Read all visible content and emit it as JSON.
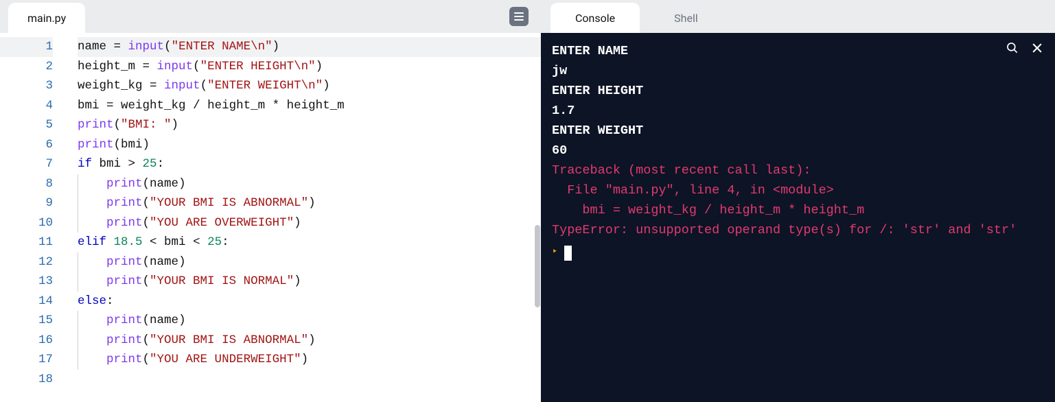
{
  "editor": {
    "filename": "main.py",
    "lines": [
      {
        "n": 1,
        "segs": [
          [
            "name",
            "name "
          ],
          [
            "op",
            "= "
          ],
          [
            "call",
            "input"
          ],
          [
            "paren",
            "("
          ],
          [
            "str",
            "\"ENTER NAME"
          ],
          [
            "esc",
            "\\n"
          ],
          [
            "str",
            "\""
          ],
          [
            "paren",
            ")"
          ]
        ]
      },
      {
        "n": 2,
        "segs": [
          [
            "name",
            "height_m "
          ],
          [
            "op",
            "= "
          ],
          [
            "call",
            "input"
          ],
          [
            "paren",
            "("
          ],
          [
            "str",
            "\"ENTER HEIGHT"
          ],
          [
            "esc",
            "\\n"
          ],
          [
            "str",
            "\""
          ],
          [
            "paren",
            ")"
          ]
        ]
      },
      {
        "n": 3,
        "segs": [
          [
            "name",
            "weight_kg "
          ],
          [
            "op",
            "= "
          ],
          [
            "call",
            "input"
          ],
          [
            "paren",
            "("
          ],
          [
            "str",
            "\"ENTER WEIGHT"
          ],
          [
            "esc",
            "\\n"
          ],
          [
            "str",
            "\""
          ],
          [
            "paren",
            ")"
          ]
        ]
      },
      {
        "n": 4,
        "segs": [
          [
            "name",
            "bmi "
          ],
          [
            "op",
            "= "
          ],
          [
            "name",
            "weight_kg "
          ],
          [
            "op",
            "/ "
          ],
          [
            "name",
            "height_m "
          ],
          [
            "op",
            "* "
          ],
          [
            "name",
            "height_m"
          ]
        ]
      },
      {
        "n": 5,
        "segs": [
          [
            "call",
            "print"
          ],
          [
            "paren",
            "("
          ],
          [
            "str",
            "\"BMI: \""
          ],
          [
            "paren",
            ")"
          ]
        ]
      },
      {
        "n": 6,
        "segs": [
          [
            "call",
            "print"
          ],
          [
            "paren",
            "("
          ],
          [
            "name",
            "bmi"
          ],
          [
            "paren",
            ")"
          ]
        ]
      },
      {
        "n": 7,
        "segs": [
          [
            "kw",
            "if "
          ],
          [
            "name",
            "bmi "
          ],
          [
            "op",
            "> "
          ],
          [
            "num",
            "25"
          ],
          [
            "op",
            ":"
          ]
        ]
      },
      {
        "n": 8,
        "indent": 1,
        "segs": [
          [
            "call",
            "print"
          ],
          [
            "paren",
            "("
          ],
          [
            "name",
            "name"
          ],
          [
            "paren",
            ")"
          ]
        ]
      },
      {
        "n": 9,
        "indent": 1,
        "segs": [
          [
            "call",
            "print"
          ],
          [
            "paren",
            "("
          ],
          [
            "str",
            "\"YOUR BMI IS ABNORMAL\""
          ],
          [
            "paren",
            ")"
          ]
        ]
      },
      {
        "n": 10,
        "indent": 1,
        "segs": [
          [
            "call",
            "print"
          ],
          [
            "paren",
            "("
          ],
          [
            "str",
            "\"YOU ARE OVERWEIGHT\""
          ],
          [
            "paren",
            ")"
          ]
        ]
      },
      {
        "n": 11,
        "segs": [
          [
            "kw",
            "elif "
          ],
          [
            "num",
            "18.5"
          ],
          [
            "op",
            " < "
          ],
          [
            "name",
            "bmi "
          ],
          [
            "op",
            "< "
          ],
          [
            "num",
            "25"
          ],
          [
            "op",
            ":"
          ]
        ]
      },
      {
        "n": 12,
        "indent": 1,
        "segs": [
          [
            "call",
            "print"
          ],
          [
            "paren",
            "("
          ],
          [
            "name",
            "name"
          ],
          [
            "paren",
            ")"
          ]
        ]
      },
      {
        "n": 13,
        "indent": 1,
        "segs": [
          [
            "call",
            "print"
          ],
          [
            "paren",
            "("
          ],
          [
            "str",
            "\"YOUR BMI IS NORMAL\""
          ],
          [
            "paren",
            ")"
          ]
        ]
      },
      {
        "n": 14,
        "segs": [
          [
            "kw",
            "else"
          ],
          [
            "op",
            ":"
          ]
        ]
      },
      {
        "n": 15,
        "indent": 1,
        "segs": [
          [
            "call",
            "print"
          ],
          [
            "paren",
            "("
          ],
          [
            "name",
            "name"
          ],
          [
            "paren",
            ")"
          ]
        ]
      },
      {
        "n": 16,
        "indent": 1,
        "segs": [
          [
            "call",
            "print"
          ],
          [
            "paren",
            "("
          ],
          [
            "str",
            "\"YOUR BMI IS ABNORMAL\""
          ],
          [
            "paren",
            ")"
          ]
        ]
      },
      {
        "n": 17,
        "indent": 1,
        "segs": [
          [
            "call",
            "print"
          ],
          [
            "paren",
            "("
          ],
          [
            "str",
            "\"YOU ARE UNDERWEIGHT\""
          ],
          [
            "paren",
            ")"
          ]
        ]
      },
      {
        "n": 18,
        "segs": []
      }
    ],
    "activeLine": 1
  },
  "rightTabs": {
    "console": "Console",
    "shell": "Shell",
    "active": "console"
  },
  "console": {
    "lines": [
      {
        "cls": "cout",
        "text": "ENTER NAME"
      },
      {
        "cls": "cout",
        "text": "jw"
      },
      {
        "cls": "cout",
        "text": "ENTER HEIGHT"
      },
      {
        "cls": "cout",
        "text": "1.7"
      },
      {
        "cls": "cout",
        "text": "ENTER WEIGHT"
      },
      {
        "cls": "cout",
        "text": "60"
      },
      {
        "cls": "cerr",
        "text": "Traceback (most recent call last):"
      },
      {
        "cls": "cerr",
        "text": "  File \"main.py\", line 4, in <module>"
      },
      {
        "cls": "cerr",
        "text": "    bmi = weight_kg / height_m * height_m"
      },
      {
        "cls": "cerr",
        "text": "TypeError: unsupported operand type(s) for /: 'str' and 'str'"
      }
    ],
    "promptSymbol": "‣"
  }
}
